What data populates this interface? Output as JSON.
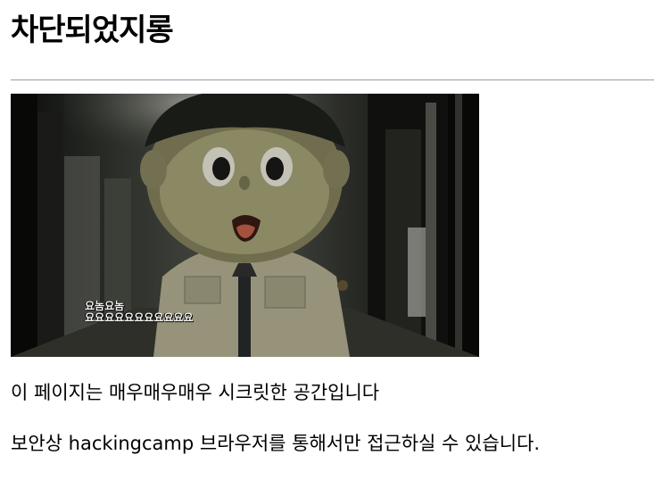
{
  "page": {
    "title": "차단되었지롱",
    "image": {
      "caption_line1": "요놈요놈",
      "caption_line2": "요요요요요요요요요요요"
    },
    "paragraph1": "이 페이지는 매우매우매우 시크릿한 공간입니다",
    "paragraph2": "보안상 hackingcamp 브라우저를 통해서만 접근하실 수 있습니다."
  },
  "colors": {
    "text": "#000000",
    "background": "#ffffff",
    "divider": "#a8a8a8"
  }
}
